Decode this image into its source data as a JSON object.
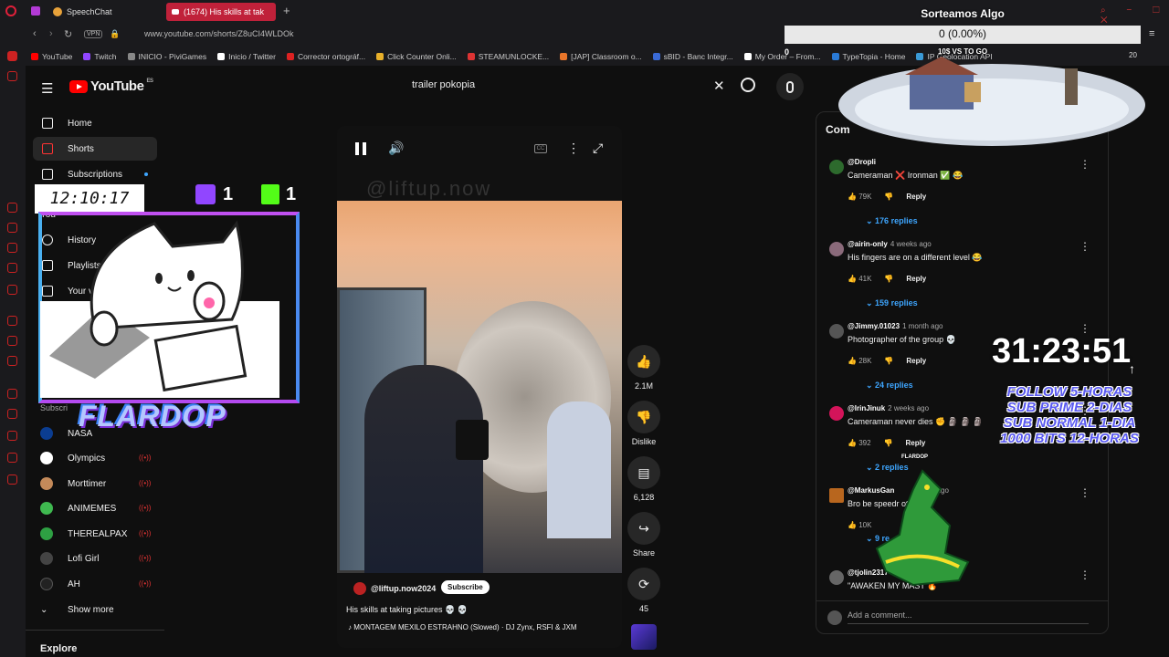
{
  "browser": {
    "tabs": [
      {
        "label": "SpeechChat",
        "active": false
      },
      {
        "label": "(1674) His skills at tak",
        "active": true
      }
    ],
    "url": "www.youtube.com/shorts/Z8uCI4WLDOk",
    "vpn": "VPN",
    "bookmarks": [
      "YouTube",
      "Twitch",
      "INICIO - PiviGames",
      "Inicio / Twitter",
      "Corrector ortográf...",
      "Click Counter Onli...",
      "STEAMUNLOCKE...",
      "[JAP] Classroom o...",
      "sBID - Banc Integr...",
      "My Order – From...",
      "TypeTopia - Home",
      "IP Geolocation API"
    ],
    "bookmarks_count": "20"
  },
  "header": {
    "logo_text": "YouTube",
    "logo_region": "ES",
    "search_value": "trailer pokopia"
  },
  "sidebar": {
    "main": [
      {
        "label": "Home",
        "icon": "home-icon"
      },
      {
        "label": "Shorts",
        "icon": "shorts-icon"
      },
      {
        "label": "Subscriptions",
        "icon": "subscriptions-icon"
      }
    ],
    "you_label": "You",
    "you_items": [
      {
        "label": "History",
        "icon": "history-icon"
      },
      {
        "label": "Playlists",
        "icon": "playlists-icon"
      },
      {
        "label": "Your vi",
        "icon": "your-videos-icon"
      }
    ],
    "subscriptions_label": "Subscri",
    "subscriptions": [
      {
        "label": "NASA",
        "color": "#0b3d91"
      },
      {
        "label": "Olympics",
        "color": "#ffffff"
      },
      {
        "label": "Morttimer",
        "color": "#c48a5a"
      },
      {
        "label": "ANIMEMES",
        "color": "#3fb950"
      },
      {
        "label": "THEREALPAX",
        "color": "#2ea043"
      },
      {
        "label": "Lofi Girl",
        "color": "#444444"
      },
      {
        "label": "AH",
        "color": "#222222"
      }
    ],
    "show_more": "Show more",
    "explore": "Explore"
  },
  "video": {
    "channel": "@liftup.now2024",
    "subscribe": "Subscribe",
    "title": "His skills at taking pictures 💀 💀",
    "music": "MONTAGEM MEXILO ESTRAHNO (Slowed) · DJ Zynx, RSFI & JXM",
    "watermark": "@liftup.now"
  },
  "actions": [
    {
      "label": "2.1M",
      "icon": "like-icon"
    },
    {
      "label": "Dislike",
      "icon": "dislike-icon"
    },
    {
      "label": "6,128",
      "icon": "comments-icon"
    },
    {
      "label": "Share",
      "icon": "share-icon"
    },
    {
      "label": "45",
      "icon": "remix-icon"
    }
  ],
  "comments": {
    "heading": "Com",
    "items": [
      {
        "author": "@Dropli",
        "time": "",
        "text": "Cameraman ❌ Ironman ✅ 😂",
        "likes": "79K",
        "replies": "176 replies",
        "color": "#2d6a2d"
      },
      {
        "author": "@airin-only",
        "time": "4 weeks ago",
        "text": "His fingers are on a different level 😂",
        "likes": "41K",
        "replies": "159 replies",
        "color": "#8a6a7a"
      },
      {
        "author": "@Jimmy.01023",
        "time": "1 month ago",
        "text": "Photographer of the group 💀",
        "likes": "28K",
        "replies": "24 replies",
        "color": "#555555"
      },
      {
        "author": "@IrinJinuk",
        "time": "2 weeks ago",
        "text": "Cameraman never dies ✊ 🗿 🗿 🗿",
        "likes": "392",
        "replies": "2 replies",
        "color": "#d4145a"
      },
      {
        "author": "@MarkusGan",
        "time": "s ago",
        "text": "Bro be speedr          otos",
        "likes": "10K",
        "replies": "9 re",
        "color": "#b8661e"
      },
      {
        "author": "@tjolin2317",
        "time": "",
        "text": "\"AWAKEN MY MAST 🔥",
        "likes": "",
        "replies": "",
        "color": "#666666"
      }
    ],
    "add_placeholder": "Add a comment...",
    "reply_label": "Reply"
  },
  "overlays": {
    "sorteo_title": "Sorteamos Algo",
    "sorteo_progress": "0 (0.00%)",
    "sorteo_min": "0",
    "sorteo_goal": "10$ VS TO GO",
    "clock": "12:10:17",
    "twitch_count": "1",
    "kick_count": "1",
    "streamer": "FLARDOP",
    "timer": "31:23:51",
    "promo": [
      "FOLLOW 5-HORAS",
      "SUB PRIME 2-DIAS",
      "SUB NORMAL 1-DIA",
      "1000 BITS 12-HORAS"
    ],
    "mini_label": "FLARDOP"
  }
}
